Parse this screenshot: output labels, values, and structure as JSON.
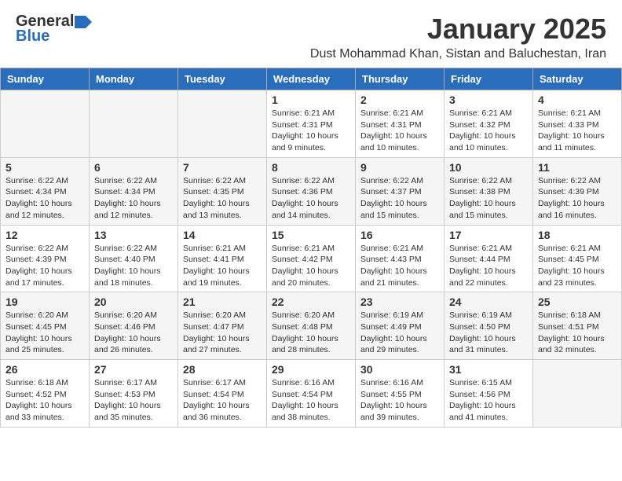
{
  "header": {
    "logo_general": "General",
    "logo_blue": "Blue",
    "month": "January 2025",
    "location": "Dust Mohammad Khan, Sistan and Baluchestan, Iran"
  },
  "days_of_week": [
    "Sunday",
    "Monday",
    "Tuesday",
    "Wednesday",
    "Thursday",
    "Friday",
    "Saturday"
  ],
  "weeks": [
    [
      {
        "day": "",
        "empty": true
      },
      {
        "day": "",
        "empty": true
      },
      {
        "day": "",
        "empty": true
      },
      {
        "day": "1",
        "sunrise": "6:21 AM",
        "sunset": "4:31 PM",
        "daylight": "10 hours and 9 minutes."
      },
      {
        "day": "2",
        "sunrise": "6:21 AM",
        "sunset": "4:31 PM",
        "daylight": "10 hours and 10 minutes."
      },
      {
        "day": "3",
        "sunrise": "6:21 AM",
        "sunset": "4:32 PM",
        "daylight": "10 hours and 10 minutes."
      },
      {
        "day": "4",
        "sunrise": "6:21 AM",
        "sunset": "4:33 PM",
        "daylight": "10 hours and 11 minutes."
      }
    ],
    [
      {
        "day": "5",
        "sunrise": "6:22 AM",
        "sunset": "4:34 PM",
        "daylight": "10 hours and 12 minutes."
      },
      {
        "day": "6",
        "sunrise": "6:22 AM",
        "sunset": "4:34 PM",
        "daylight": "10 hours and 12 minutes."
      },
      {
        "day": "7",
        "sunrise": "6:22 AM",
        "sunset": "4:35 PM",
        "daylight": "10 hours and 13 minutes."
      },
      {
        "day": "8",
        "sunrise": "6:22 AM",
        "sunset": "4:36 PM",
        "daylight": "10 hours and 14 minutes."
      },
      {
        "day": "9",
        "sunrise": "6:22 AM",
        "sunset": "4:37 PM",
        "daylight": "10 hours and 15 minutes."
      },
      {
        "day": "10",
        "sunrise": "6:22 AM",
        "sunset": "4:38 PM",
        "daylight": "10 hours and 15 minutes."
      },
      {
        "day": "11",
        "sunrise": "6:22 AM",
        "sunset": "4:39 PM",
        "daylight": "10 hours and 16 minutes."
      }
    ],
    [
      {
        "day": "12",
        "sunrise": "6:22 AM",
        "sunset": "4:39 PM",
        "daylight": "10 hours and 17 minutes."
      },
      {
        "day": "13",
        "sunrise": "6:22 AM",
        "sunset": "4:40 PM",
        "daylight": "10 hours and 18 minutes."
      },
      {
        "day": "14",
        "sunrise": "6:21 AM",
        "sunset": "4:41 PM",
        "daylight": "10 hours and 19 minutes."
      },
      {
        "day": "15",
        "sunrise": "6:21 AM",
        "sunset": "4:42 PM",
        "daylight": "10 hours and 20 minutes."
      },
      {
        "day": "16",
        "sunrise": "6:21 AM",
        "sunset": "4:43 PM",
        "daylight": "10 hours and 21 minutes."
      },
      {
        "day": "17",
        "sunrise": "6:21 AM",
        "sunset": "4:44 PM",
        "daylight": "10 hours and 22 minutes."
      },
      {
        "day": "18",
        "sunrise": "6:21 AM",
        "sunset": "4:45 PM",
        "daylight": "10 hours and 23 minutes."
      }
    ],
    [
      {
        "day": "19",
        "sunrise": "6:20 AM",
        "sunset": "4:45 PM",
        "daylight": "10 hours and 25 minutes."
      },
      {
        "day": "20",
        "sunrise": "6:20 AM",
        "sunset": "4:46 PM",
        "daylight": "10 hours and 26 minutes."
      },
      {
        "day": "21",
        "sunrise": "6:20 AM",
        "sunset": "4:47 PM",
        "daylight": "10 hours and 27 minutes."
      },
      {
        "day": "22",
        "sunrise": "6:20 AM",
        "sunset": "4:48 PM",
        "daylight": "10 hours and 28 minutes."
      },
      {
        "day": "23",
        "sunrise": "6:19 AM",
        "sunset": "4:49 PM",
        "daylight": "10 hours and 29 minutes."
      },
      {
        "day": "24",
        "sunrise": "6:19 AM",
        "sunset": "4:50 PM",
        "daylight": "10 hours and 31 minutes."
      },
      {
        "day": "25",
        "sunrise": "6:18 AM",
        "sunset": "4:51 PM",
        "daylight": "10 hours and 32 minutes."
      }
    ],
    [
      {
        "day": "26",
        "sunrise": "6:18 AM",
        "sunset": "4:52 PM",
        "daylight": "10 hours and 33 minutes."
      },
      {
        "day": "27",
        "sunrise": "6:17 AM",
        "sunset": "4:53 PM",
        "daylight": "10 hours and 35 minutes."
      },
      {
        "day": "28",
        "sunrise": "6:17 AM",
        "sunset": "4:54 PM",
        "daylight": "10 hours and 36 minutes."
      },
      {
        "day": "29",
        "sunrise": "6:16 AM",
        "sunset": "4:54 PM",
        "daylight": "10 hours and 38 minutes."
      },
      {
        "day": "30",
        "sunrise": "6:16 AM",
        "sunset": "4:55 PM",
        "daylight": "10 hours and 39 minutes."
      },
      {
        "day": "31",
        "sunrise": "6:15 AM",
        "sunset": "4:56 PM",
        "daylight": "10 hours and 41 minutes."
      },
      {
        "day": "",
        "empty": true
      }
    ]
  ]
}
